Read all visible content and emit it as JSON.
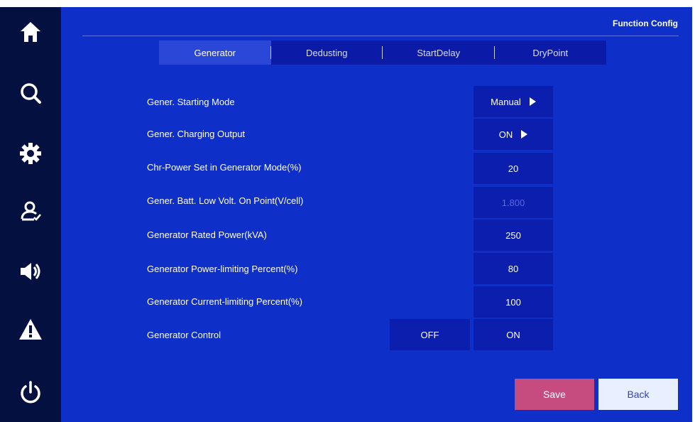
{
  "header": {
    "title": "Function Config"
  },
  "sidebar": {
    "icons": [
      "home-icon",
      "search-icon",
      "settings-gear-icon",
      "user-icon",
      "speaker-icon",
      "warning-icon",
      "power-icon"
    ]
  },
  "tabs": [
    {
      "label": "Generator",
      "active": true
    },
    {
      "label": "Dedusting",
      "active": false
    },
    {
      "label": "StartDelay",
      "active": false
    },
    {
      "label": "DryPoint",
      "active": false
    }
  ],
  "rows": [
    {
      "label": "Gener. Starting Mode",
      "value": "Manual",
      "has_arrow": true
    },
    {
      "label": "Gener. Charging Output",
      "value": "ON",
      "has_arrow": true
    },
    {
      "label": "Chr-Power Set in Generator Mode(%)",
      "value": "20"
    },
    {
      "label": "Gener. Batt. Low Volt. On Point(V/cell)",
      "value": "1.800",
      "disabled": true
    },
    {
      "label": "Generator Rated Power(kVA)",
      "value": "250"
    },
    {
      "label": "Generator Power-limiting Percent(%)",
      "value": "80"
    },
    {
      "label": "Generator Current-limiting Percent(%)",
      "value": "100"
    },
    {
      "label": "Generator Control",
      "off_label": "OFF",
      "on_label": "ON"
    }
  ],
  "buttons": {
    "save": "Save",
    "back": "Back"
  },
  "colors": {
    "background": "#0f2fc9",
    "sidebar": "#04103f",
    "save_button": "#c64b7e",
    "back_button": "#e8f0ff"
  }
}
